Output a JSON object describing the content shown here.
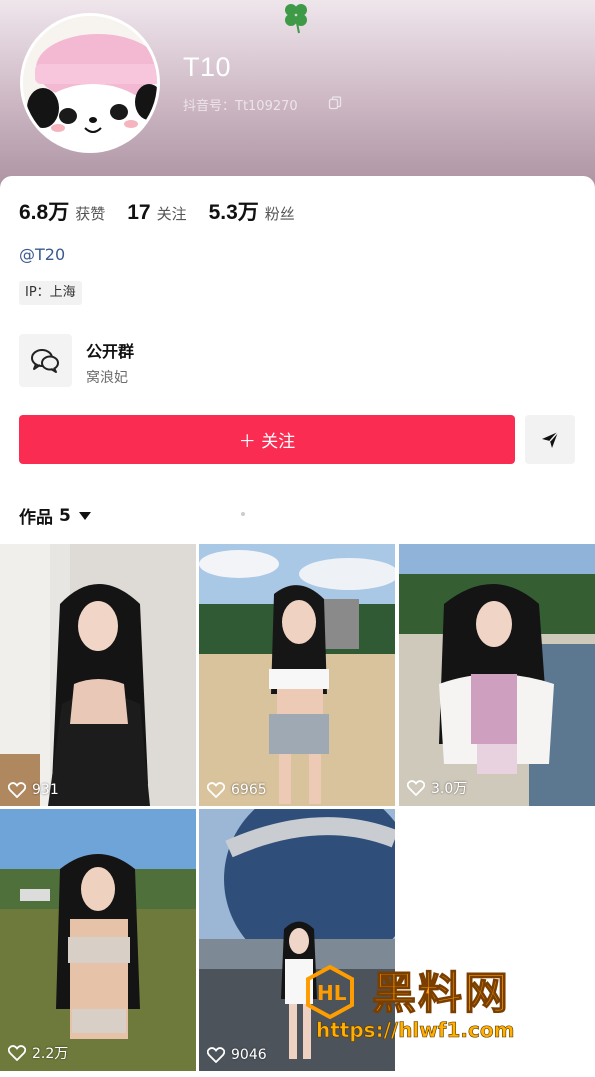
{
  "profile": {
    "nickname": "T10",
    "douyin_id": "抖音号：Tt109270",
    "mention": "@T20",
    "ip": "IP：上海"
  },
  "stats": [
    {
      "value": "6.8万",
      "label": "获赞"
    },
    {
      "value": "17",
      "label": "关注"
    },
    {
      "value": "5.3万",
      "label": "粉丝"
    }
  ],
  "group": {
    "title": "公开群",
    "subtitle": "窝浪妃"
  },
  "actions": {
    "follow_label": "＋ 关注"
  },
  "works": {
    "label": "作品",
    "count": "5"
  },
  "videos": [
    {
      "likes": "931"
    },
    {
      "likes": "6965"
    },
    {
      "likes": "3.0万"
    },
    {
      "likes": "2.2万"
    },
    {
      "likes": "9046"
    }
  ],
  "watermark": {
    "text": "黑料网",
    "url": "https://hlwf1.com"
  },
  "colors": {
    "accent": "#fb2c52",
    "mention": "#3b5b8f"
  }
}
